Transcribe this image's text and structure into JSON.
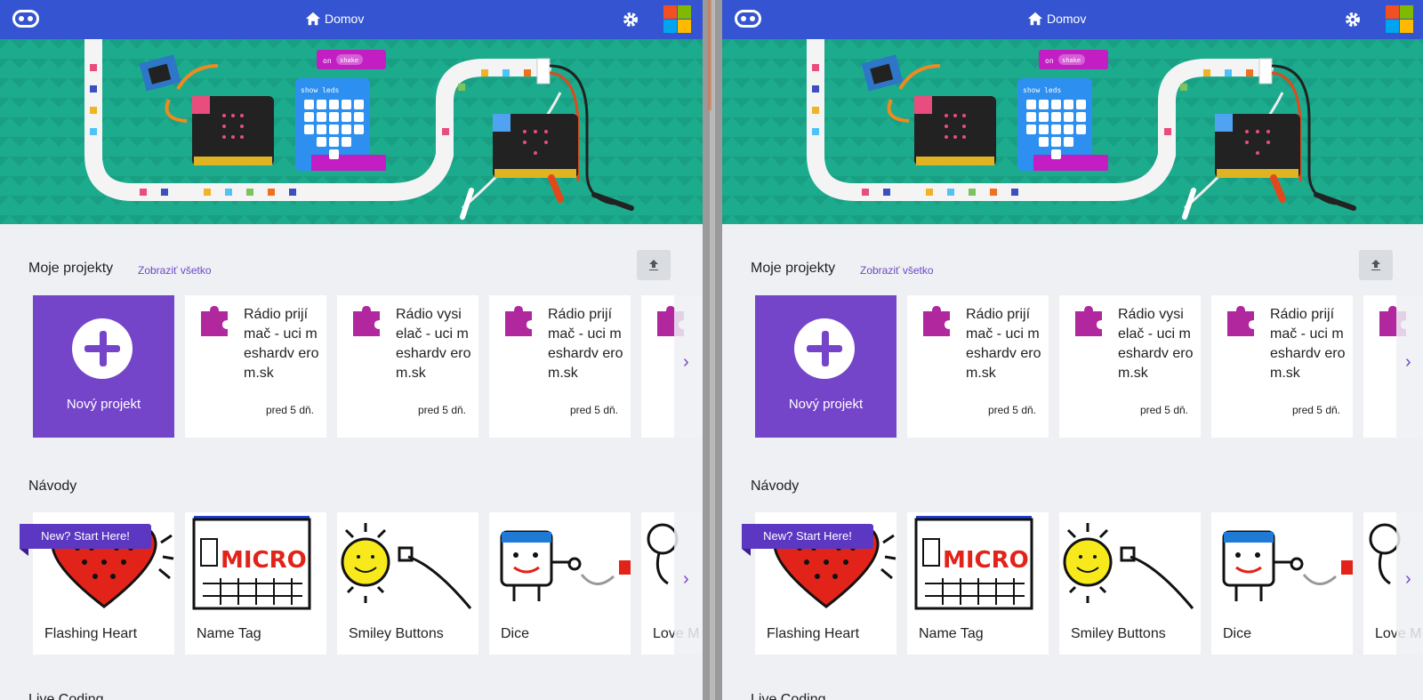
{
  "header": {
    "home_label": "Domov"
  },
  "projects": {
    "title": "Moje projekty",
    "view_all": "Zobraziť všetko",
    "new_project": "Nový projekt",
    "items": [
      {
        "name": "Rádio prijí mač - uci meshardv erom.sk",
        "time": "pred 5 dň."
      },
      {
        "name": "Rádio vysi elač - uci meshardv erom.sk",
        "time": "pred 5 dň."
      },
      {
        "name": "Rádio prijí mač - uci meshardv erom.sk",
        "time": "pred 5 dň."
      }
    ]
  },
  "tutorials": {
    "title": "Návody",
    "badge": "New? Start Here!",
    "items": [
      {
        "label": "Flashing Heart",
        "icon": "heart"
      },
      {
        "label": "Name Tag",
        "icon": "name-tag"
      },
      {
        "label": "Smiley Buttons",
        "icon": "smiley"
      },
      {
        "label": "Dice",
        "icon": "dice"
      },
      {
        "label": "Love M",
        "icon": "love-meter"
      }
    ]
  },
  "next_section_title": "Live Coding",
  "hero_blocks": {
    "event": "on",
    "event_arg": "shake",
    "action": "show leds"
  },
  "colors": {
    "topbar": "#3454d1",
    "accent": "#7445c9",
    "hero": "#1dab8d"
  }
}
